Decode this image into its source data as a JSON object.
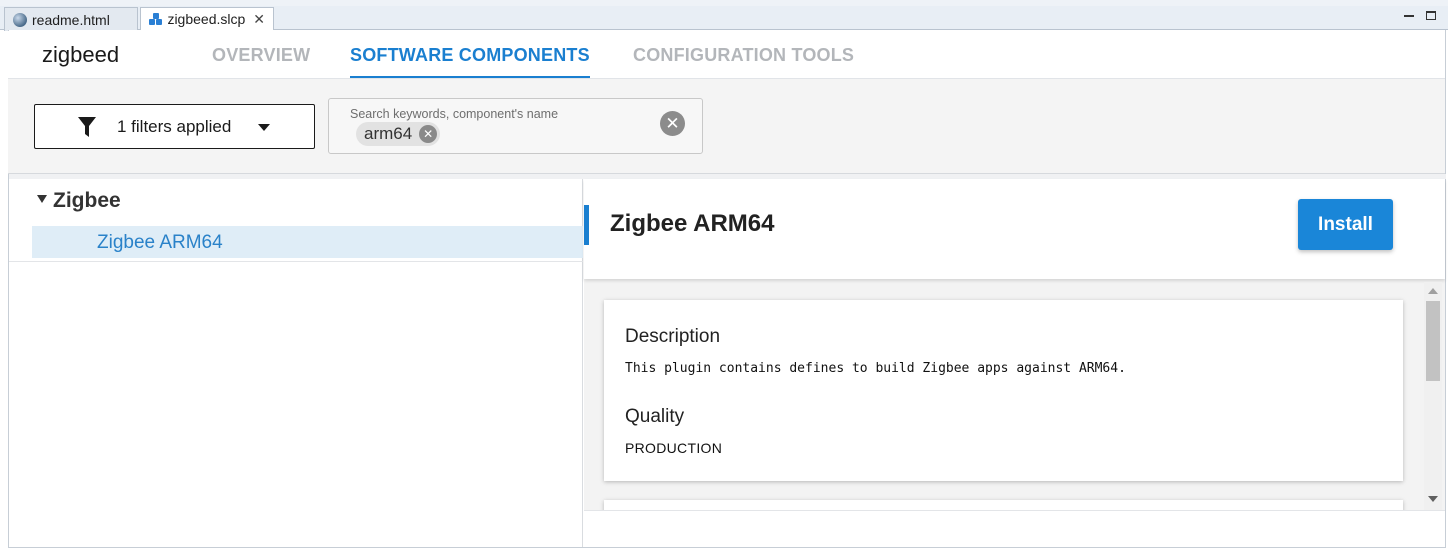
{
  "editor_tabs": [
    {
      "label": "readme.html",
      "icon": "globe-icon",
      "active": false
    },
    {
      "label": "zigbeed.slcp",
      "icon": "slcp-project-icon",
      "active": true,
      "close": "✕"
    }
  ],
  "header": {
    "app_title": "zigbeed",
    "tabs": [
      {
        "label": "OVERVIEW",
        "active": false
      },
      {
        "label": "SOFTWARE COMPONENTS",
        "active": true
      },
      {
        "label": "CONFIGURATION TOOLS",
        "active": false
      }
    ]
  },
  "filters": {
    "button_label": "1 filters applied",
    "icon": "funnel-icon"
  },
  "search": {
    "placeholder": "Search keywords, component's name",
    "chip": "arm64",
    "chip_remove": "✕",
    "clear": "✕"
  },
  "tree": {
    "group": "Zigbee",
    "item": "Zigbee ARM64"
  },
  "detail": {
    "title": "Zigbee ARM64",
    "install_label": "Install",
    "description_heading": "Description",
    "description_text": "This plugin contains defines to build Zigbee apps against ARM64.",
    "quality_heading": "Quality",
    "quality_value": "PRODUCTION"
  },
  "colors": {
    "accent": "#1a7fd0",
    "install_bg": "#1a86d8",
    "selected_row": "#dfedf7",
    "inactive_tab": "#b3b6ba"
  }
}
